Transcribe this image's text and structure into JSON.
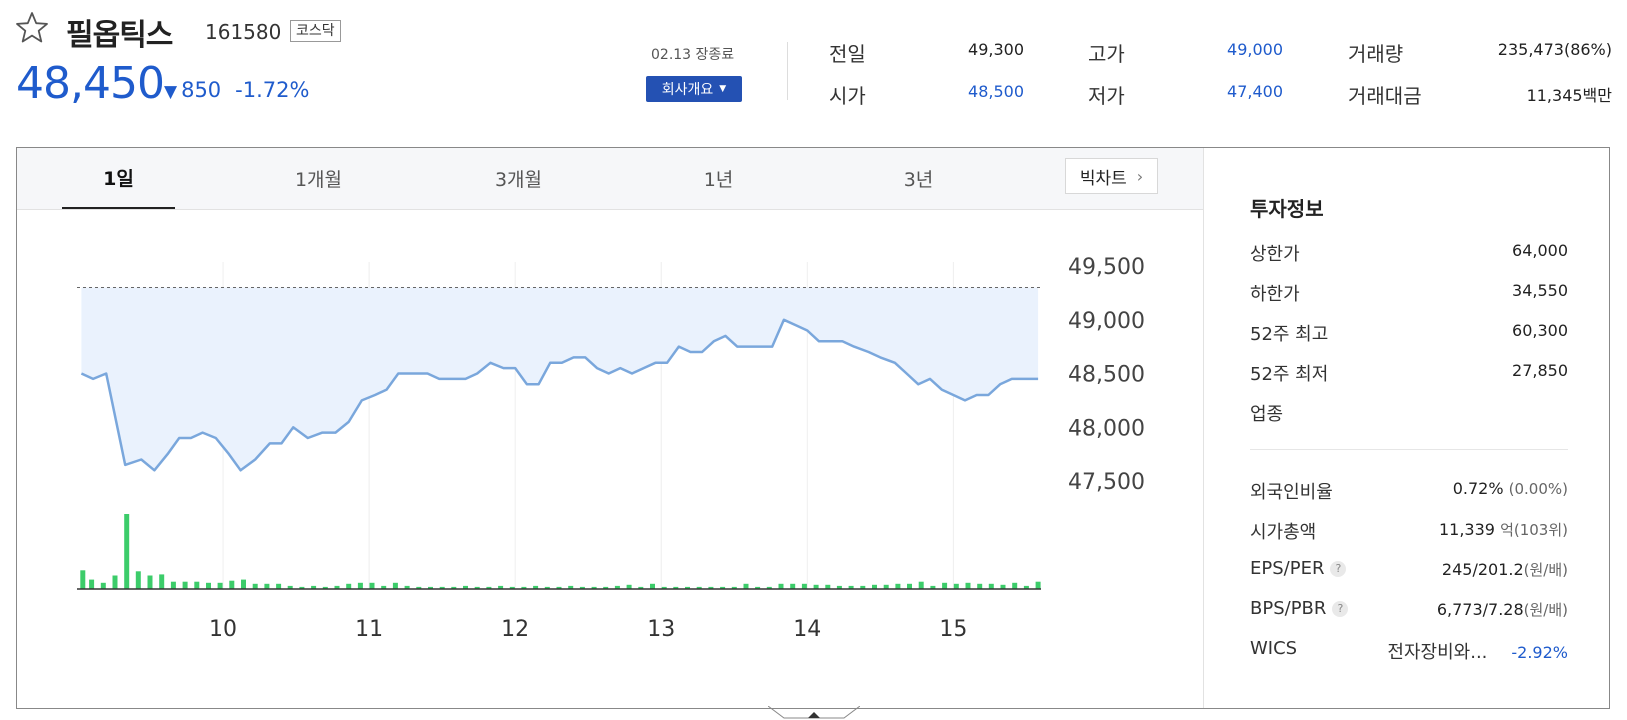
{
  "stock": {
    "name": "필옵틱스",
    "code": "161580",
    "market": "코스닥",
    "price": "48,450",
    "change": "850",
    "change_rate": "-1.72%",
    "market_status": "02.13 장종료",
    "company_button": "회사개요"
  },
  "quote": {
    "prev_label": "전일",
    "prev": "49,300",
    "open_label": "시가",
    "open": "48,500",
    "high_label": "고가",
    "high": "49,000",
    "low_label": "저가",
    "low": "47,400",
    "volume_label": "거래량",
    "volume": "235,473(86%)",
    "amount_label": "거래대금",
    "amount": "11,345백만"
  },
  "tabs": [
    "1일",
    "1개월",
    "3개월",
    "1년",
    "3년"
  ],
  "big_chart_label": "빅차트",
  "invest_info": {
    "title": "투자정보",
    "upper_limit_label": "상한가",
    "upper_limit": "64,000",
    "lower_limit_label": "하한가",
    "lower_limit": "34,550",
    "high52_label": "52주 최고",
    "high52": "60,300",
    "low52_label": "52주 최저",
    "low52": "27,850",
    "industry_label": "업종",
    "foreign_label": "외국인비율",
    "foreign": "0.72%",
    "foreign_sub": "(0.00%)",
    "mcap_label": "시가총액",
    "mcap": "11,339",
    "mcap_sub": "억(103위)",
    "eps_label": "EPS/PER",
    "eps": "245/201.2",
    "eps_sub": "(원/배)",
    "bps_label": "BPS/PBR",
    "bps": "6,773/7.28",
    "bps_sub": "(원/배)",
    "wics_label": "WICS",
    "wics": "전자장비와...",
    "wics_change": "-2.92%"
  },
  "colors": {
    "up": "#e0201b",
    "down": "#1f5bcc",
    "line": "#7aa7dc",
    "fill": "#eaf2fd",
    "volume": "#3ccc6a"
  },
  "chart_data": {
    "type": "line",
    "x_ticks": [
      "10",
      "11",
      "12",
      "13",
      "14",
      "15"
    ],
    "y_ticks": [
      "49,500",
      "49,000",
      "48,500",
      "48,000",
      "47,500"
    ],
    "ylim": [
      47500,
      49500
    ],
    "prev_close": 49300,
    "time_range": [
      9.0,
      15.6
    ],
    "series": [
      {
        "x": [
          9.03,
          9.11,
          9.2,
          9.33,
          9.44,
          9.53,
          9.62,
          9.7,
          9.78,
          9.86,
          9.95,
          10.04,
          10.12,
          10.22,
          10.32,
          10.4,
          10.48,
          10.58,
          10.68,
          10.77,
          10.86,
          10.95,
          11.04,
          11.12,
          11.2,
          11.3,
          11.4,
          11.48,
          11.56,
          11.66,
          11.74,
          11.83,
          11.92,
          12.0,
          12.08,
          12.16,
          12.24,
          12.32,
          12.4,
          12.48,
          12.56,
          12.64,
          12.72,
          12.8,
          12.88,
          12.96,
          13.04,
          13.12,
          13.2,
          13.28,
          13.36,
          13.44,
          13.52,
          13.6,
          13.68,
          13.76,
          13.84,
          13.92,
          14.0,
          14.08,
          14.16,
          14.24,
          14.32,
          14.42,
          14.5,
          14.6,
          14.68,
          14.76,
          14.84,
          14.92,
          15.0,
          15.08,
          15.16,
          15.24,
          15.32,
          15.4,
          15.5,
          15.58
        ],
        "values": [
          48500,
          48450,
          48500,
          47650,
          47700,
          47600,
          47750,
          47900,
          47900,
          47950,
          47900,
          47750,
          47600,
          47700,
          47850,
          47850,
          48000,
          47900,
          47950,
          47950,
          48050,
          48250,
          48300,
          48350,
          48500,
          48500,
          48500,
          48450,
          48450,
          48450,
          48500,
          48600,
          48550,
          48550,
          48400,
          48400,
          48600,
          48600,
          48650,
          48650,
          48550,
          48500,
          48550,
          48500,
          48550,
          48600,
          48600,
          48750,
          48700,
          48700,
          48800,
          48850,
          48750,
          48750,
          48750,
          48750,
          49000,
          48950,
          48900,
          48800,
          48800,
          48800,
          48750,
          48700,
          48650,
          48600,
          48500,
          48400,
          48450,
          48350,
          48300,
          48250,
          48300,
          48300,
          48400,
          48450,
          48450,
          48450
        ]
      }
    ],
    "volume": {
      "x": [
        9.04,
        9.1,
        9.18,
        9.26,
        9.34,
        9.42,
        9.5,
        9.58,
        9.66,
        9.74,
        9.82,
        9.9,
        9.98,
        10.06,
        10.14,
        10.22,
        10.3,
        10.38,
        10.46,
        10.54,
        10.62,
        10.7,
        10.78,
        10.86,
        10.94,
        11.02,
        11.1,
        11.18,
        11.26,
        11.34,
        11.42,
        11.5,
        11.58,
        11.66,
        11.74,
        11.82,
        11.9,
        11.98,
        12.06,
        12.14,
        12.22,
        12.3,
        12.38,
        12.46,
        12.54,
        12.62,
        12.7,
        12.78,
        12.86,
        12.94,
        13.02,
        13.1,
        13.18,
        13.26,
        13.34,
        13.42,
        13.5,
        13.58,
        13.66,
        13.74,
        13.82,
        13.9,
        13.98,
        14.06,
        14.14,
        14.22,
        14.3,
        14.38,
        14.46,
        14.54,
        14.62,
        14.7,
        14.78,
        14.86,
        14.94,
        15.02,
        15.1,
        15.18,
        15.26,
        15.34,
        15.42,
        15.5,
        15.58
      ],
      "values": [
        18,
        9,
        6,
        13,
        72,
        17,
        13,
        14,
        7,
        7,
        7,
        6,
        6,
        8,
        9,
        5,
        5,
        5,
        3,
        2,
        3,
        2,
        3,
        5,
        6,
        6,
        3,
        6,
        3,
        2,
        2,
        2,
        2,
        3,
        2,
        2,
        3,
        2,
        2,
        3,
        2,
        2,
        3,
        2,
        2,
        2,
        3,
        4,
        2,
        5,
        2,
        2,
        2,
        2,
        2,
        2,
        2,
        5,
        2,
        2,
        5,
        5,
        5,
        4,
        4,
        3,
        3,
        3,
        4,
        4,
        5,
        5,
        7,
        3,
        6,
        5,
        6,
        5,
        5,
        4,
        6,
        3,
        7
      ]
    }
  }
}
